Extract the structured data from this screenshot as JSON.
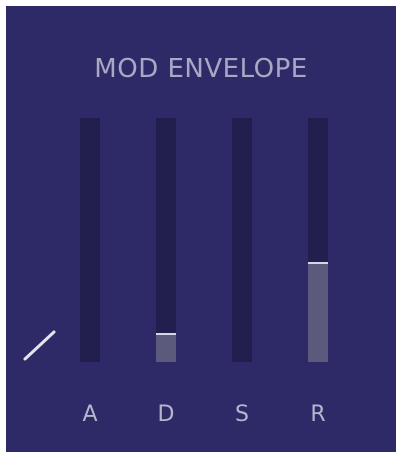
{
  "panel": {
    "title": "MOD ENVELOPE"
  },
  "sliders": [
    {
      "label": "A",
      "level": 0.0
    },
    {
      "label": "D",
      "level": 0.12
    },
    {
      "label": "S",
      "level": 0.0
    },
    {
      "label": "R",
      "level": 0.41
    }
  ],
  "icons": {
    "shape": "envelope-shape-icon"
  },
  "colors": {
    "panel_bg": "#2e2a67",
    "track_bg": "#221f4f",
    "fill": "#5c5a7c",
    "fill_edge": "#d7d6e6",
    "text": "#a8a8c4"
  }
}
